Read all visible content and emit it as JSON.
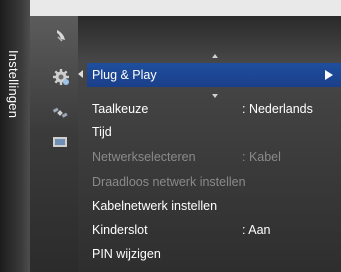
{
  "panel": {
    "category_title": "Instellingen"
  },
  "icons": [
    "antenna-icon",
    "gear-icon",
    "satellite-icon",
    "input-source-icon"
  ],
  "menu": {
    "items": [
      {
        "label": "Plug & Play",
        "value": "",
        "state": "selected"
      },
      {
        "label": "Taalkeuze",
        "value": ": Nederlands",
        "state": "enabled"
      },
      {
        "label": "Tijd",
        "value": "",
        "state": "enabled"
      },
      {
        "label": "Netwerkselecteren",
        "value": ": Kabel",
        "state": "disabled"
      },
      {
        "label": "Draadloos netwerk instellen",
        "value": "",
        "state": "disabled"
      },
      {
        "label": "Kabelnetwerk instellen",
        "value": "",
        "state": "enabled"
      },
      {
        "label": "Kinderslot",
        "value": ": Aan",
        "state": "enabled"
      },
      {
        "label": "PIN wijzigen",
        "value": "",
        "state": "enabled"
      }
    ]
  },
  "colors": {
    "highlight": "#1e4f9e",
    "text": "#ffffff",
    "disabled_text": "#8a8a8a"
  }
}
